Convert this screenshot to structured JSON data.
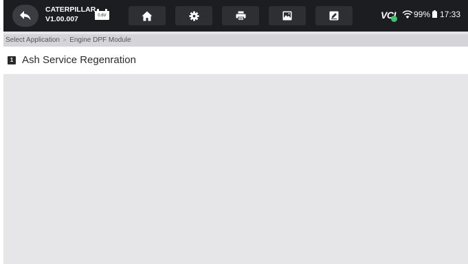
{
  "app": {
    "name": "CATERPILLAR",
    "version": "V1.00.007",
    "battery_voltage": "0.6V"
  },
  "toolbar": {
    "icons": [
      "back-arrow-icon",
      "home-icon",
      "gear-icon",
      "printer-icon",
      "image-icon",
      "edit-icon"
    ]
  },
  "status": {
    "vci_label": "VCI",
    "vci_connected_color": "#3bc66b",
    "battery_percent": "99%",
    "time": "17:33"
  },
  "breadcrumb": {
    "root": "Select Application",
    "separator": ">",
    "current": "Engine DPF Module"
  },
  "list": {
    "items": [
      {
        "number": "1",
        "label": "Ash Service Regenration"
      }
    ]
  },
  "colors": {
    "topbar": "#1c1d21",
    "content_bg": "#e6e5e8",
    "breadcrumb_bg": "#d5d4d9"
  }
}
